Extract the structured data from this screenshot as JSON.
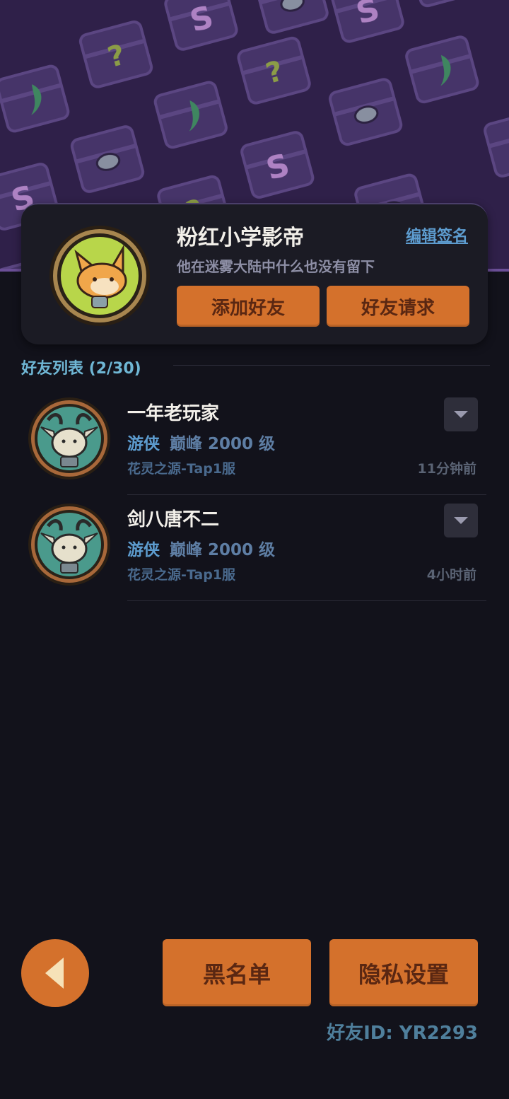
{
  "profile": {
    "name": "粉红小学影帝",
    "edit_sign_label": "编辑签名",
    "signature": "他在迷雾大陆中什么也没有留下",
    "add_friend_label": "添加好友",
    "friend_request_label": "好友请求"
  },
  "friend_list": {
    "title": "好友列表 (2/30)",
    "items": [
      {
        "name": "一年老玩家",
        "class": "游侠",
        "level": "巅峰 2000 级",
        "server": "花灵之源-Tap1服",
        "last_online": "11分钟前"
      },
      {
        "name": "剑八唐不二",
        "class": "游侠",
        "level": "巅峰 2000 级",
        "server": "花灵之源-Tap1服",
        "last_online": "4小时前"
      }
    ]
  },
  "bottom": {
    "blacklist_label": "黑名单",
    "privacy_label": "隐私设置",
    "friend_id": "好友ID: YR2293"
  },
  "colors": {
    "accent_orange": "#d4712c",
    "link_blue": "#5d9ccf",
    "title_teal": "#6fb6d4",
    "background": "#12121b"
  }
}
